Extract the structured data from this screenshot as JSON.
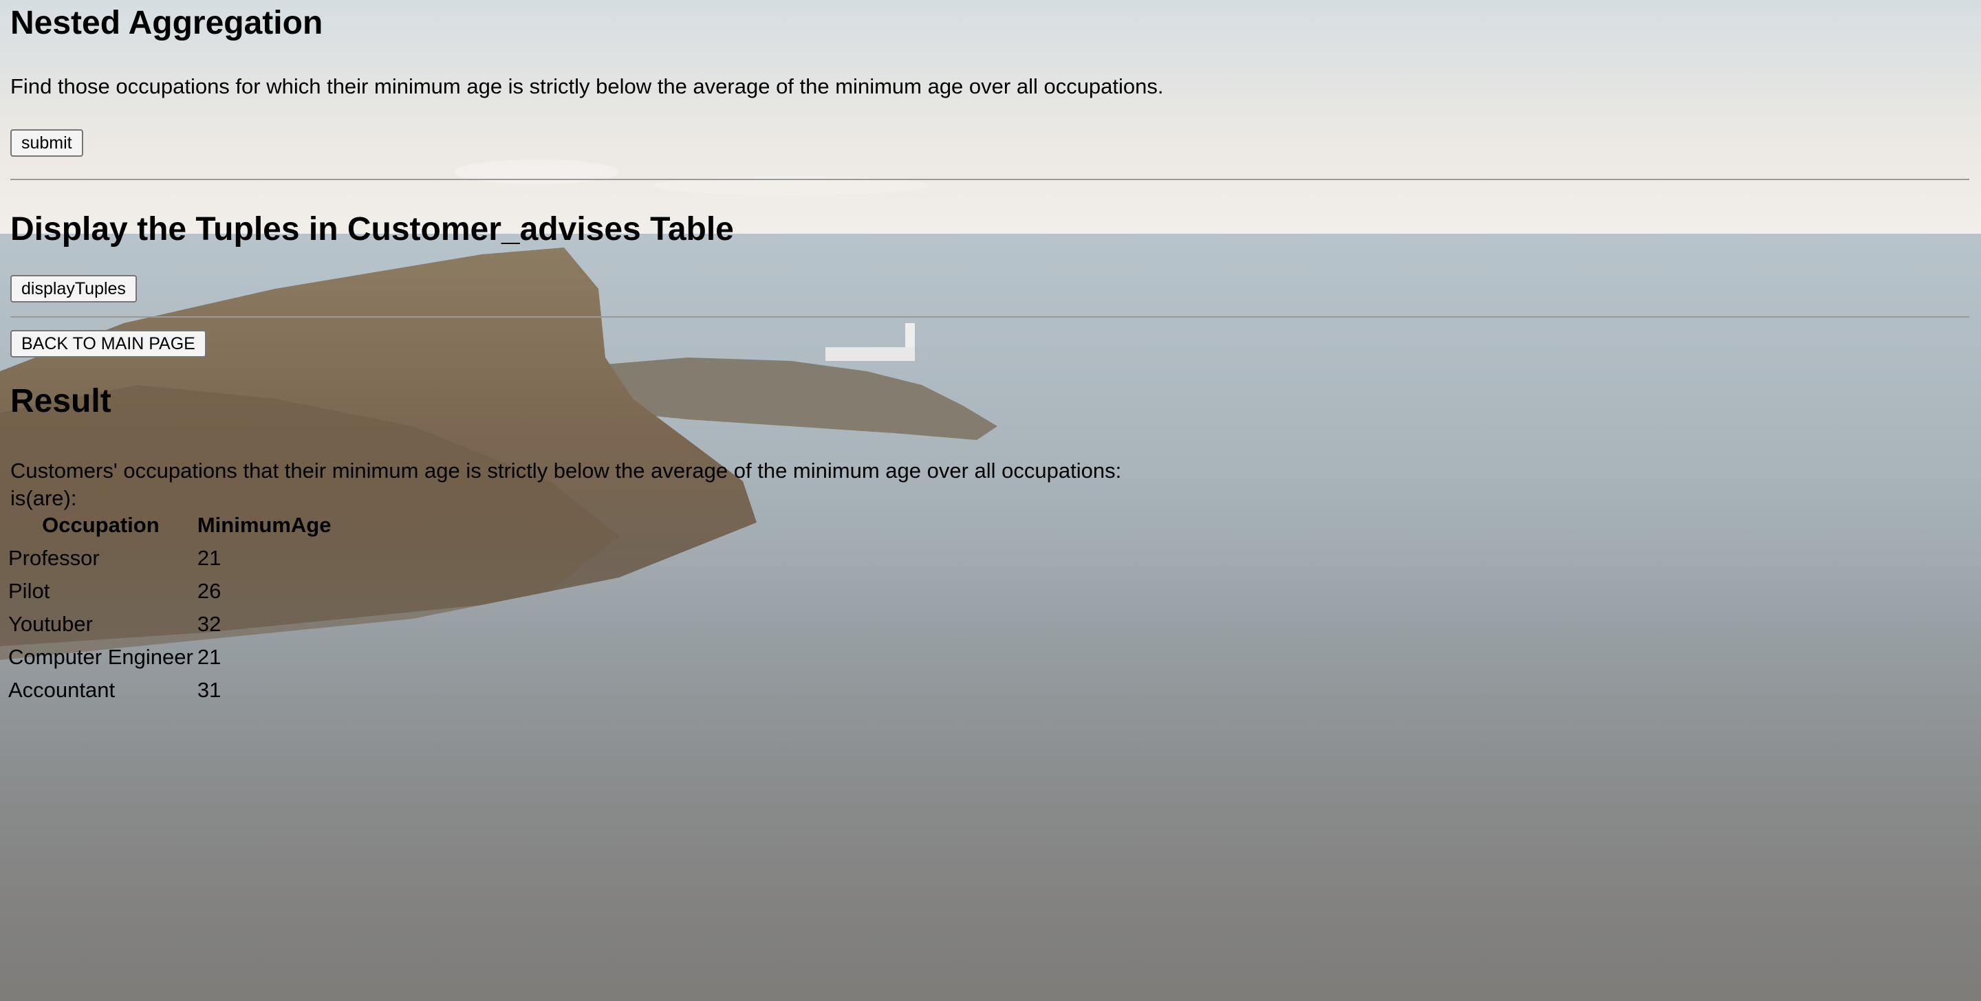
{
  "nested": {
    "title": "Nested Aggregation",
    "description": "Find those occupations for which their minimum age is strictly below the average of the minimum age over all occupations.",
    "submit_label": "submit"
  },
  "display": {
    "title": "Display the Tuples in Customer_advises Table",
    "button_label": "displayTuples"
  },
  "back_label": "BACK TO MAIN PAGE",
  "result": {
    "title": "Result",
    "caption": "Customers' occupations that their minimum age is strictly below the average of the minimum age over all occupations:",
    "caption2": "is(are):",
    "columns": [
      "Occupation",
      "MinimumAge"
    ],
    "rows": [
      [
        "Professor",
        "21"
      ],
      [
        "Pilot",
        "26"
      ],
      [
        "Youtuber",
        "32"
      ],
      [
        "Computer Engineer",
        "21"
      ],
      [
        "Accountant",
        "31"
      ]
    ]
  },
  "colors": {
    "sky_top": "#d4dbe0",
    "sea": "#8e9aa3",
    "cliff": "#7a6a52",
    "foreground": "#84817d"
  }
}
